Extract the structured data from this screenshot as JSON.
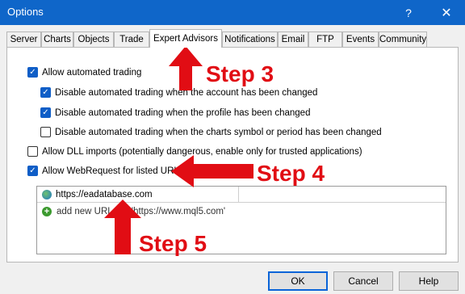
{
  "window": {
    "title": "Options",
    "help_icon": "?",
    "close_icon": "✕"
  },
  "tabs": [
    {
      "label": "Server"
    },
    {
      "label": "Charts"
    },
    {
      "label": "Objects"
    },
    {
      "label": "Trade"
    },
    {
      "label": "Expert Advisors",
      "active": true
    },
    {
      "label": "Notifications"
    },
    {
      "label": "Email"
    },
    {
      "label": "FTP"
    },
    {
      "label": "Events"
    },
    {
      "label": "Community"
    }
  ],
  "options": {
    "allow_automated": {
      "label": "Allow automated trading",
      "checked": true
    },
    "disable_account": {
      "label": "Disable automated trading when the account has been changed",
      "checked": true
    },
    "disable_profile": {
      "label": "Disable automated trading when the profile has been changed",
      "checked": true
    },
    "disable_symbol": {
      "label": "Disable automated trading when the charts symbol or period has been changed",
      "checked": false
    },
    "allow_dll": {
      "label": "Allow DLL imports (potentially dangerous, enable only for trusted applications)",
      "checked": false
    },
    "allow_webrequest": {
      "label": "Allow WebRequest for listed URL:",
      "checked": true
    }
  },
  "url_list": {
    "items": [
      "https://eadatabase.com"
    ],
    "add_new": "add new URL like 'https://www.mql5.com'"
  },
  "buttons": {
    "ok": "OK",
    "cancel": "Cancel",
    "help": "Help"
  },
  "annotations": {
    "step3": "Step 3",
    "step4": "Step 4",
    "step5": "Step 5",
    "color": "#e10d14"
  },
  "colors": {
    "titlebar": "#0f66c9",
    "checkbox": "#0f5ec7",
    "accent": "#0a64d8"
  }
}
